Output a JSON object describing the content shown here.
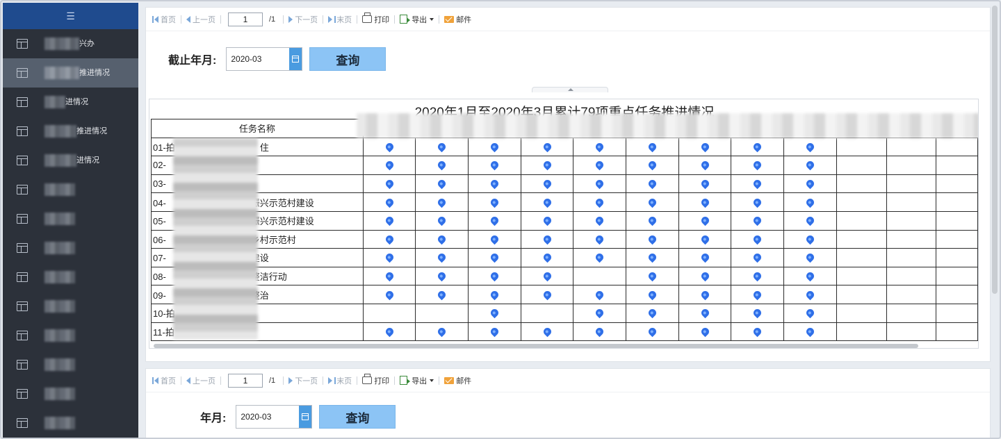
{
  "sidebar": {
    "menu_glyph": "☰",
    "items": [
      {
        "label": "兴办",
        "blur": 50
      },
      {
        "label": "推进情况",
        "blur": 50,
        "active": true
      },
      {
        "label": "进情况",
        "blur": 30
      },
      {
        "label": "推进情况",
        "blur": 46
      },
      {
        "label": "进情况",
        "blur": 46
      },
      {
        "label": "",
        "blur": 44
      },
      {
        "label": "",
        "blur": 44
      },
      {
        "label": "",
        "blur": 44
      },
      {
        "label": "",
        "blur": 44
      },
      {
        "label": "",
        "blur": 44
      },
      {
        "label": "",
        "blur": 44
      },
      {
        "label": "",
        "blur": 44
      },
      {
        "label": "",
        "blur": 44
      },
      {
        "label": "",
        "blur": 44
      }
    ]
  },
  "toolbar": {
    "first": "首页",
    "prev": "上一页",
    "page_value": "1",
    "total": "/1",
    "next": "下一页",
    "last": "末页",
    "print": "打印",
    "export": "导出",
    "mail": "邮件"
  },
  "query1": {
    "label": "截止年月:",
    "date": "2020-03",
    "button": "查询"
  },
  "query2": {
    "label": "年月:",
    "date": "2020-03",
    "button": "查询"
  },
  "report": {
    "title": "2020年1月至2020年3月累计79项重点任务推进情况",
    "column_header": "任务名称",
    "rows": [
      {
        "name": "01-拍",
        "suffix": "住",
        "marks": [
          1,
          1,
          1,
          1,
          1,
          1,
          1,
          1,
          1,
          0,
          0,
          0
        ]
      },
      {
        "name": "02-",
        "suffix": "",
        "marks": [
          1,
          1,
          1,
          1,
          1,
          1,
          1,
          1,
          1,
          0,
          0,
          0
        ]
      },
      {
        "name": "03-",
        "suffix": "",
        "marks": [
          1,
          1,
          1,
          1,
          1,
          1,
          1,
          1,
          1,
          0,
          0,
          0
        ]
      },
      {
        "name": "04-",
        "suffix": "振兴示范村建设",
        "marks": [
          1,
          1,
          1,
          1,
          1,
          1,
          1,
          1,
          1,
          0,
          0,
          0
        ]
      },
      {
        "name": "05-",
        "suffix": "振兴示范村建设",
        "marks": [
          1,
          1,
          1,
          1,
          1,
          1,
          1,
          1,
          1,
          0,
          0,
          0
        ]
      },
      {
        "name": "06-",
        "suffix": "乡村示范村",
        "marks": [
          1,
          1,
          1,
          1,
          1,
          1,
          1,
          1,
          1,
          0,
          0,
          0
        ]
      },
      {
        "name": "07-",
        "suffix": "建设",
        "marks": [
          1,
          1,
          1,
          1,
          1,
          1,
          1,
          1,
          1,
          0,
          0,
          0
        ]
      },
      {
        "name": "08-",
        "suffix": "整洁行动",
        "marks": [
          1,
          1,
          1,
          1,
          0,
          1,
          1,
          1,
          1,
          0,
          0,
          0
        ]
      },
      {
        "name": "09-",
        "suffix": "整治",
        "marks": [
          1,
          1,
          1,
          1,
          1,
          1,
          1,
          1,
          1,
          0,
          0,
          0
        ]
      },
      {
        "name": "10-拍",
        "suffix": "",
        "marks": [
          0,
          0,
          1,
          0,
          1,
          1,
          1,
          1,
          1,
          0,
          0,
          0
        ]
      },
      {
        "name": "11-拍",
        "suffix": "",
        "marks": [
          1,
          1,
          1,
          1,
          1,
          1,
          1,
          1,
          1,
          0,
          0,
          0
        ]
      }
    ]
  },
  "colors": {
    "pin": "#2f6fe8",
    "sidebar": "#2c313a",
    "sidebar_top": "#1f4b8e",
    "query_button": "#8cc4f5"
  }
}
